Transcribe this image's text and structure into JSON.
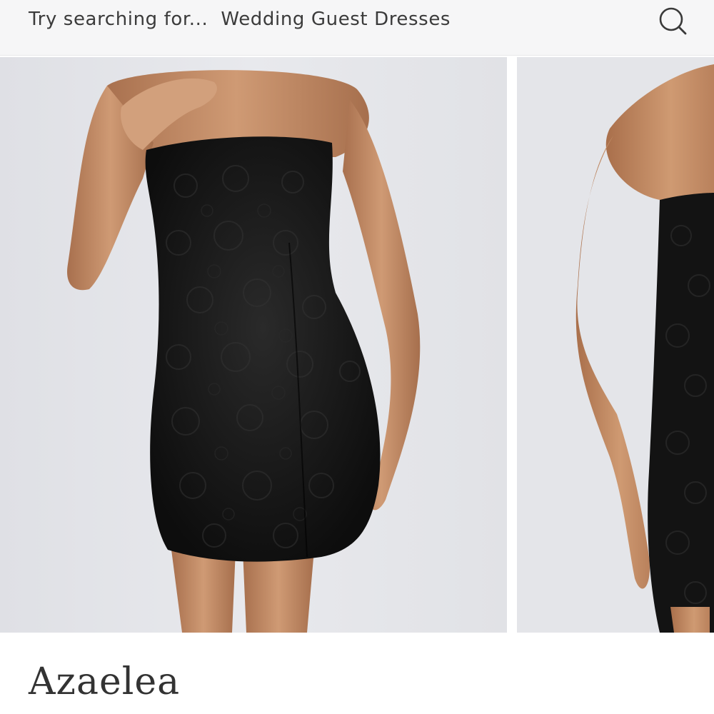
{
  "search": {
    "prefix": "Try searching for...",
    "suggestion": "Wedding Guest Dresses",
    "icon": "search-icon"
  },
  "gallery": {
    "images": [
      {
        "description": "model-front-view"
      },
      {
        "description": "model-back-view"
      }
    ]
  },
  "product": {
    "title": "Azaelea"
  },
  "colors": {
    "search_bar_bg": "#f6f6f7",
    "photo_bg": "#e3e4e8",
    "dress": "#141414",
    "skin": "#c8936e"
  }
}
